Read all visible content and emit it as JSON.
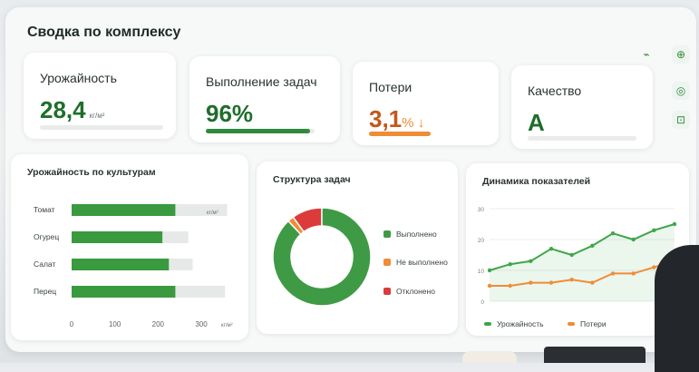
{
  "title": "Сводка по комплексу",
  "kpis": [
    {
      "label": "Урожайность",
      "value": "28,4",
      "unit": "кг/м²",
      "color": "#1f6e2c",
      "bar": null
    },
    {
      "label": "Выполнение задач",
      "value": "96%",
      "unit": "",
      "color": "#1f6e2c",
      "bar": {
        "level": 0.96,
        "color": "#2e8b3d"
      }
    },
    {
      "label": "Потери",
      "value": "3,1",
      "suffix": "% ↓",
      "unit": "",
      "color": "#c2571a",
      "suffix_color": "#ef8c35",
      "bar": {
        "level": 0.5,
        "color": "#ef8c35"
      }
    },
    {
      "label": "Качество",
      "value": "A",
      "unit": "",
      "color": "#1f6e2c",
      "bar": null
    }
  ],
  "side_icons": [
    "trend-icon",
    "plus-icon",
    "circle-icon",
    "lock-icon"
  ],
  "charts": {
    "yield": {
      "title": "Урожайность по культурам",
      "unit": "кг/м²",
      "x_ticks": [
        "0",
        "100",
        "200",
        "300"
      ],
      "x_unit": "кг/м²"
    },
    "tasks": {
      "title": "Структура задач",
      "legend": [
        {
          "label": "Выполнено",
          "color": "#3f9a45"
        },
        {
          "label": "Не выполнено",
          "color": "#ef8c35"
        },
        {
          "label": "Отклонено",
          "color": "#dc3b3b"
        }
      ]
    },
    "dynamics": {
      "title": "Динамика показателей",
      "y_ticks": [
        "30",
        "20",
        "10",
        "0"
      ],
      "legend": [
        {
          "label": "Урожайность",
          "color": "#3fa64a"
        },
        {
          "label": "Потери",
          "color": "#ef8c35"
        }
      ]
    }
  },
  "chart_data": [
    {
      "type": "bar",
      "title": "Урожайность по культурам",
      "categories": [
        "Томат",
        "Огурец",
        "Салат",
        "Перец"
      ],
      "series": [
        {
          "values": [
            240,
            210,
            225,
            240
          ],
          "color": "#3a9a3f"
        },
        {
          "values": [
            360,
            270,
            280,
            355
          ],
          "color": "#e6e9e7"
        }
      ],
      "xlim": [
        0,
        300
      ],
      "xlabel": "кг/м²"
    },
    {
      "type": "pie",
      "title": "Структура задач",
      "categories": [
        "Выполнено",
        "Не выполнено",
        "Отклонено"
      ],
      "values": [
        88,
        2,
        10
      ],
      "colors": [
        "#3f9a45",
        "#ef8c35",
        "#dc3b3b"
      ]
    },
    {
      "type": "line",
      "title": "Динамика показателей",
      "x": [
        1,
        2,
        3,
        4,
        5,
        6,
        7,
        8,
        9,
        10
      ],
      "ylim": [
        0,
        30
      ],
      "series": [
        {
          "name": "Урожайность",
          "values": [
            10,
            12,
            13,
            17,
            15,
            18,
            22,
            20,
            23,
            25
          ],
          "color": "#3fa64a"
        },
        {
          "name": "Потери",
          "values": [
            5,
            5,
            6,
            6,
            7,
            6,
            9,
            9,
            11,
            13
          ],
          "color": "#ef8c35"
        }
      ]
    }
  ]
}
